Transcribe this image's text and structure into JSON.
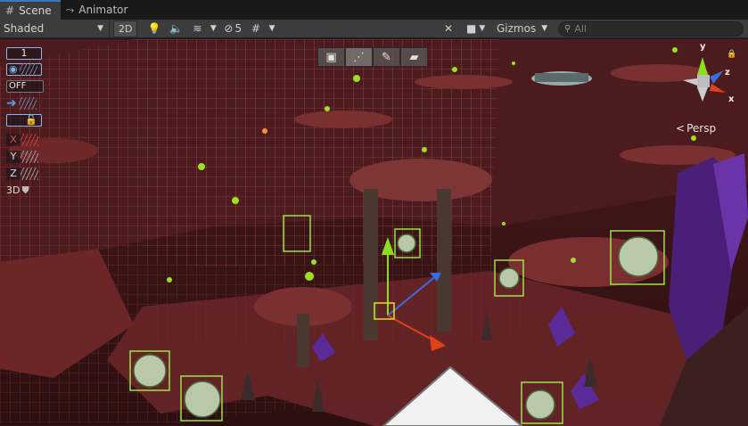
{
  "tabs": [
    {
      "label": "Scene",
      "icon": "grid-icon",
      "active": true
    },
    {
      "label": "Animator",
      "icon": "animator-icon",
      "active": false
    }
  ],
  "toolbar": {
    "shading_mode": "Shaded",
    "mode_2d": "2D",
    "hidden_count": "5",
    "gizmos_label": "Gizmos",
    "search_placeholder": "All"
  },
  "overlay_tools": {
    "layer_value": "1",
    "toggle_off": "OFF",
    "x_label": "X",
    "y_label": "Y",
    "z_label": "Z",
    "three_d_label": "3D"
  },
  "orientation_gizmo": {
    "projection_label": "Persp",
    "axis_y": "y",
    "axis_z": "z",
    "axis_x": "x"
  },
  "colors": {
    "accent": "#3a79bb",
    "grid": "#e05a5a",
    "selection_outline": "#9be24a",
    "x_axis": "#e0401a",
    "y_axis": "#8ae01a",
    "z_axis": "#3a6ce0"
  }
}
